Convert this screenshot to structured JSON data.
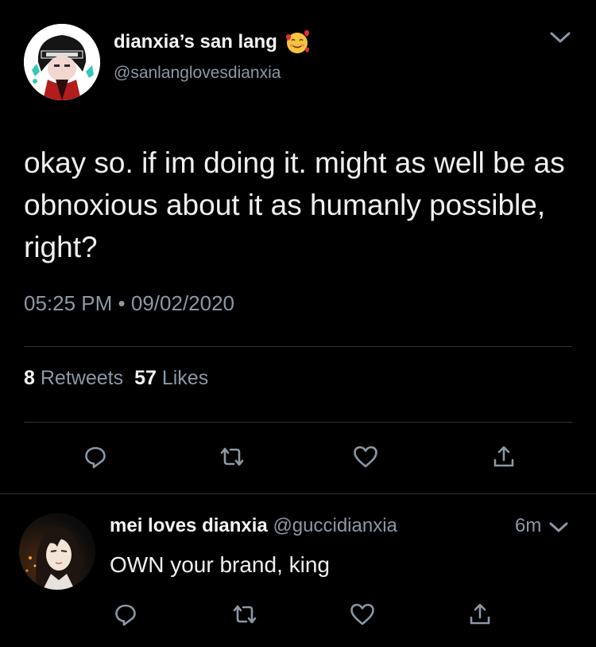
{
  "tweet": {
    "display_name": "dianxia’s san lang",
    "handle": "@sanlanglovesdianxia",
    "text": "okay so. if im doing it. might as well be as obnoxious about it as humanly possible, right?",
    "time": "05:25 PM",
    "separator": "•",
    "date": "09/02/2020",
    "retweet_count": "8",
    "retweet_label": "Retweets",
    "like_count": "57",
    "like_label": "Likes",
    "name_emoji": "smiling-face-with-hearts-icon"
  },
  "reply": {
    "display_name": "mei loves dianxia",
    "handle": "@guccidianxia",
    "time": "6m",
    "text": "OWN your brand, king"
  },
  "colors": {
    "background": "#000000",
    "text": "#f0f0f0",
    "muted": "#8b98a5",
    "divider": "#2f3336"
  },
  "icons": [
    "chevron-down-icon",
    "reply-icon",
    "retweet-icon",
    "like-icon",
    "share-icon"
  ]
}
